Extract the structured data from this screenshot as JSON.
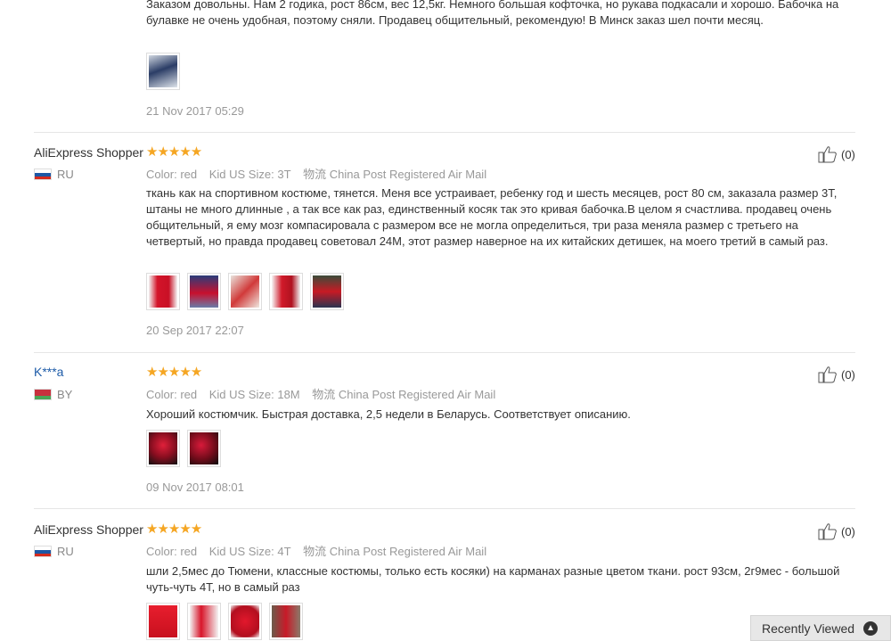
{
  "reviews": [
    {
      "text": "Заказом довольны. Нам 2 годика, рост 86см, вес 12,5кг. Немного большая кофточка, но рукава подкасали и хорошо. Бабочка на булавке не очень удобная, поэтому сняли. Продавец общительный, рекомендую! В Минск заказ шел почти месяц.",
      "date": "21 Nov 2017 05:29"
    },
    {
      "author": "AliExpress Shopper",
      "country": "RU",
      "stars": "★★★★★",
      "color_label": "Color:",
      "color_value": "red",
      "size_label": "Kid US Size:",
      "size_value": "3T",
      "ship_label": "物流",
      "ship_value": "China Post Registered Air Mail",
      "text": "ткань как на спортивном костюме, тянется. Меня все устраивает, ребенку год и шесть месяцев, рост 80 см, заказала размер 3Т, штаны не много длинные , а так все как раз, единственный косяк так это кривая бабочка.В целом я счастлива. продавец очень общительный, я ему мозг компасировала с размером все не могла определиться, три раза меняла размер с третьего на четвертый, но правда продавец советовал 24М, этот размер наверное на их китайских детишек, на моего третий в самый раз.",
      "date": "20 Sep 2017 22:07",
      "helpful": "(0)"
    },
    {
      "author": "K***a",
      "country": "BY",
      "stars": "★★★★★",
      "color_label": "Color:",
      "color_value": "red",
      "size_label": "Kid US Size:",
      "size_value": "18M",
      "ship_label": "物流",
      "ship_value": "China Post Registered Air Mail",
      "text": "Хороший костюмчик. Быстрая доставка, 2,5 недели в Беларусь. Соответствует описанию.",
      "date": "09 Nov 2017 08:01",
      "helpful": "(0)"
    },
    {
      "author": "AliExpress Shopper",
      "country": "RU",
      "stars": "★★★★★",
      "color_label": "Color:",
      "color_value": "red",
      "size_label": "Kid US Size:",
      "size_value": "4T",
      "ship_label": "物流",
      "ship_value": "China Post Registered Air Mail",
      "text": "шли 2,5мес до Тюмени, классные костюмы, только есть косяки) на карманах разные цветом ткани. рост 93см, 2г9мес - большой чуть-чуть 4Т, но в самый раз",
      "helpful": "(0)"
    }
  ],
  "recently_viewed": "Recently Viewed",
  "colors": {
    "star": "#f5a623",
    "link": "#1d5ba8",
    "muted": "#999999"
  },
  "icons": {
    "helpful": "thumbs-up-icon",
    "recent": "chevron-up-icon"
  }
}
